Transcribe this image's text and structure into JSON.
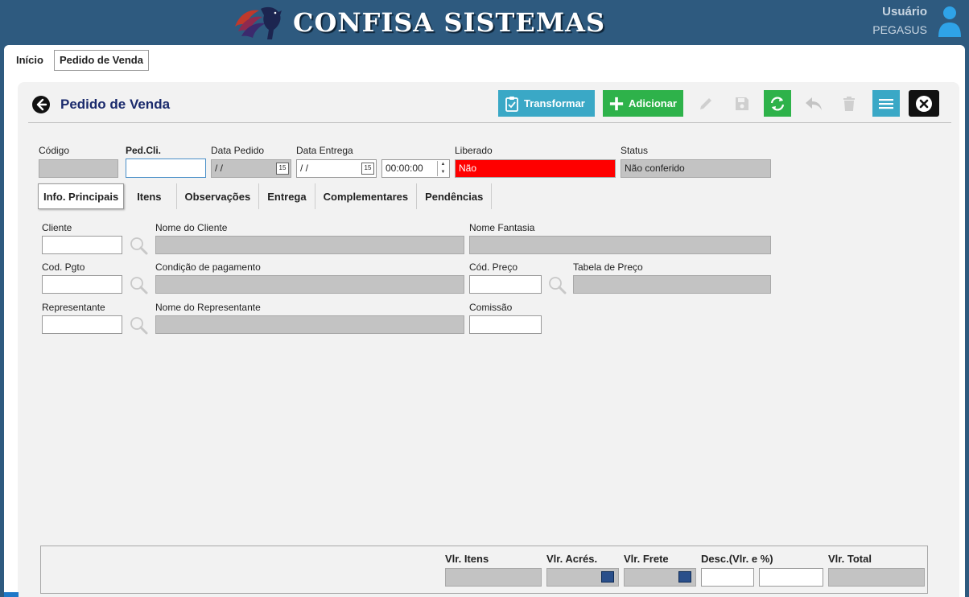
{
  "app": {
    "brand": "CONFISA SISTEMAS",
    "user_label": "Usuário",
    "user_name": "PEGASUS"
  },
  "top_tabs": [
    {
      "label": "Início"
    },
    {
      "label": "Pedido de Venda"
    }
  ],
  "page": {
    "title": "Pedido de Venda"
  },
  "toolbar": {
    "transform_label": "Transformar",
    "add_label": "Adicionar"
  },
  "header_fields": {
    "codigo": {
      "label": "Código",
      "value": ""
    },
    "ped_cli": {
      "label": "Ped.Cli.",
      "value": ""
    },
    "data_pedido": {
      "label": "Data Pedido",
      "value": " / /"
    },
    "data_entrega": {
      "label": "Data Entrega",
      "value": " / /"
    },
    "hora": {
      "value": "00:00:00"
    },
    "liberado": {
      "label": "Liberado",
      "value": "Não"
    },
    "status": {
      "label": "Status",
      "value": "Não conferido"
    }
  },
  "inner_tabs": [
    {
      "label": "Info. Principais"
    },
    {
      "label": "Itens"
    },
    {
      "label": "Observações"
    },
    {
      "label": "Entrega"
    },
    {
      "label": "Complementares"
    },
    {
      "label": "Pendências"
    }
  ],
  "form": {
    "cliente": "Cliente",
    "nome_cliente": "Nome do Cliente",
    "nome_fantasia": "Nome Fantasia",
    "cod_pgto": "Cod. Pgto",
    "condicao_pagamento": "Condição de pagamento",
    "cod_preco": "Cód. Preço",
    "tabela_preco": "Tabela de Preço",
    "representante": "Representante",
    "nome_representante": "Nome do Representante",
    "comissao": "Comissão"
  },
  "totals": {
    "vlr_itens": "Vlr. Itens",
    "vlr_acres": "Vlr. Acrés.",
    "vlr_frete": "Vlr. Frete",
    "desc": "Desc.(Vlr. e %)",
    "vlr_total": "Vlr. Total"
  },
  "colors": {
    "accent_blue": "#3aa8c6",
    "accent_green": "#2eb24a",
    "header_bg": "#2e5a7f",
    "alert_red": "#ff0000"
  },
  "icons": [
    "pegasus-logo",
    "user-icon",
    "back-arrow-icon",
    "clipboard-check-icon",
    "plus-icon",
    "pencil-icon",
    "floppy-icon",
    "refresh-icon",
    "undo-icon",
    "trash-icon",
    "menu-icon",
    "close-icon",
    "magnifier-icon",
    "calendar-icon",
    "calculator-icon"
  ]
}
